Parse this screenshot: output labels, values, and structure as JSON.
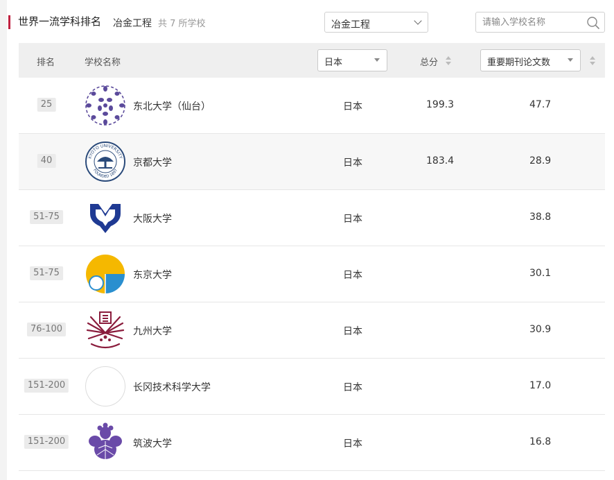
{
  "header": {
    "title": "世界一流学科排名",
    "subject": "冶金工程",
    "count_text": "共 7 所学校",
    "subject_select_value": "冶金工程",
    "search_placeholder": "请输入学校名称"
  },
  "colors": {
    "accent": "#c0203f",
    "header_bg": "#efefef",
    "rank_badge_bg": "#ebebeb"
  },
  "table": {
    "columns": {
      "rank": "排名",
      "school": "学校名称",
      "country_filter": "日本",
      "total": "总分",
      "indicator_select": "重要期刊论文数"
    },
    "rows": [
      {
        "rank": "25",
        "name": "东北大学（仙台）",
        "country": "日本",
        "total": "199.3",
        "papers": "47.7",
        "logo": "tohoku-logo"
      },
      {
        "rank": "40",
        "name": "京都大学",
        "country": "日本",
        "total": "183.4",
        "papers": "28.9",
        "logo": "kyoto-logo"
      },
      {
        "rank": "51-75",
        "name": "大阪大学",
        "country": "日本",
        "total": "",
        "papers": "38.8",
        "logo": "osaka-logo"
      },
      {
        "rank": "51-75",
        "name": "东京大学",
        "country": "日本",
        "total": "",
        "papers": "30.1",
        "logo": "tokyo-logo"
      },
      {
        "rank": "76-100",
        "name": "九州大学",
        "country": "日本",
        "total": "",
        "papers": "30.9",
        "logo": "kyushu-logo"
      },
      {
        "rank": "151-200",
        "name": "长冈技术科学大学",
        "country": "日本",
        "total": "",
        "papers": "17.0",
        "logo": "nagaoka-logo"
      },
      {
        "rank": "151-200",
        "name": "筑波大学",
        "country": "日本",
        "total": "",
        "papers": "16.8",
        "logo": "tsukuba-logo"
      }
    ]
  },
  "logo_text": {
    "kyoto_ring_top": "KYOTO UNIVERSITY",
    "kyoto_ring_bottom": "FOUNDED 1897"
  }
}
